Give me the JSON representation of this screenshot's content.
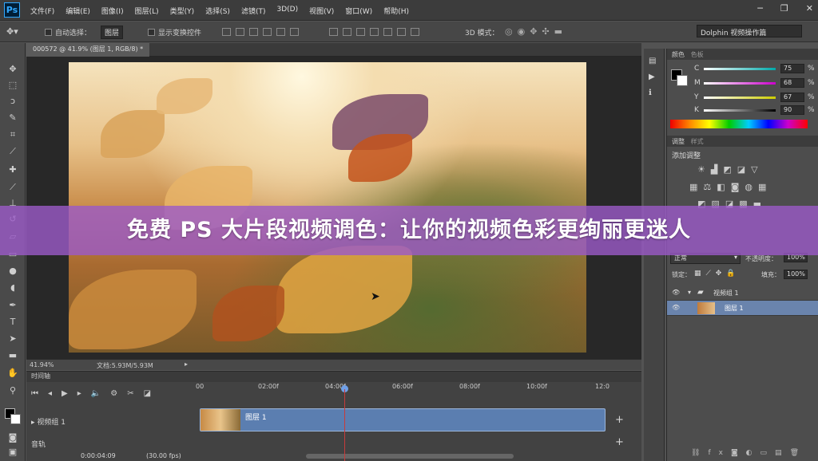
{
  "app": {
    "logo": "Ps"
  },
  "menu": [
    "文件(F)",
    "编辑(E)",
    "图像(I)",
    "图层(L)",
    "类型(Y)",
    "选择(S)",
    "滤镜(T)",
    "3D(D)",
    "视图(V)",
    "窗口(W)",
    "帮助(H)"
  ],
  "window_controls": {
    "minimize": "─",
    "restore": "❐",
    "close": "✕"
  },
  "options": {
    "auto_select": "自动选择：",
    "auto_select_value": "图层",
    "show_transform": "显示变换控件",
    "mode_3d": "3D 模式：",
    "workspace": "Dolphin 视频操作篇"
  },
  "document": {
    "tab_title": "000572 @ 41.9% (图层 1, RGB/8) *",
    "zoom": "41.94%",
    "doc_info": "文档:5.93M/5.93M"
  },
  "overlay": {
    "title": "免费 PS 大片段视频调色：让你的视频色彩更绚丽更迷人"
  },
  "color_panel": {
    "tabs": [
      "颜色",
      "色板"
    ],
    "channels": [
      {
        "label": "C",
        "value": "75",
        "unit": "%"
      },
      {
        "label": "M",
        "value": "68",
        "unit": "%"
      },
      {
        "label": "Y",
        "value": "67",
        "unit": "%"
      },
      {
        "label": "K",
        "value": "90",
        "unit": "%"
      }
    ]
  },
  "adjustments_panel": {
    "tabs": [
      "调整",
      "样式"
    ],
    "title": "添加调整"
  },
  "layers_panel": {
    "blend_mode": "正常",
    "opacity_label": "不透明度：",
    "opacity_value": "100%",
    "lock_label": "锁定：",
    "fill_label": "填充：",
    "fill_value": "100%",
    "layers": [
      {
        "name": "视频组 1"
      },
      {
        "name": "图层 1"
      }
    ]
  },
  "timeline": {
    "title": "时间轴",
    "ruler": [
      "00",
      "02:00f",
      "04:00f",
      "06:00f",
      "08:00f",
      "10:00f",
      "12:0"
    ],
    "group_label": "视频组 1",
    "clip_label": "图层 1",
    "audio_label": "音轨",
    "timecode": "0:00:04:09",
    "fps": "(30.00 fps)"
  }
}
